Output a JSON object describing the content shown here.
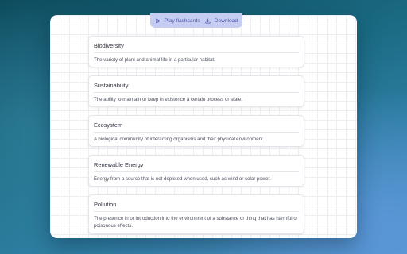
{
  "toolbar": {
    "play_label": "Play flashcards",
    "download_label": "Download",
    "play_icon": "play-icon",
    "download_icon": "download-icon"
  },
  "cards": [
    {
      "term": "Biodiversity",
      "definition": "The variety of plant and animal life in a particular habitat."
    },
    {
      "term": "Sustainability",
      "definition": "The ability to maintain or keep in existence a certain process or state."
    },
    {
      "term": "Ecosystem",
      "definition": "A biological community of interacting organisms and their physical environment."
    },
    {
      "term": "Renewable Energy",
      "definition": "Energy from a source that is not depleted when used, such as wind or solar power."
    },
    {
      "term": "Pollution",
      "definition": "The presence in or introduction into the environment of a substance or thing that has harmful or poisonous effects."
    }
  ],
  "colors": {
    "toolbar_bg": "#c7cdf2",
    "toolbar_text": "#4a55a6"
  }
}
